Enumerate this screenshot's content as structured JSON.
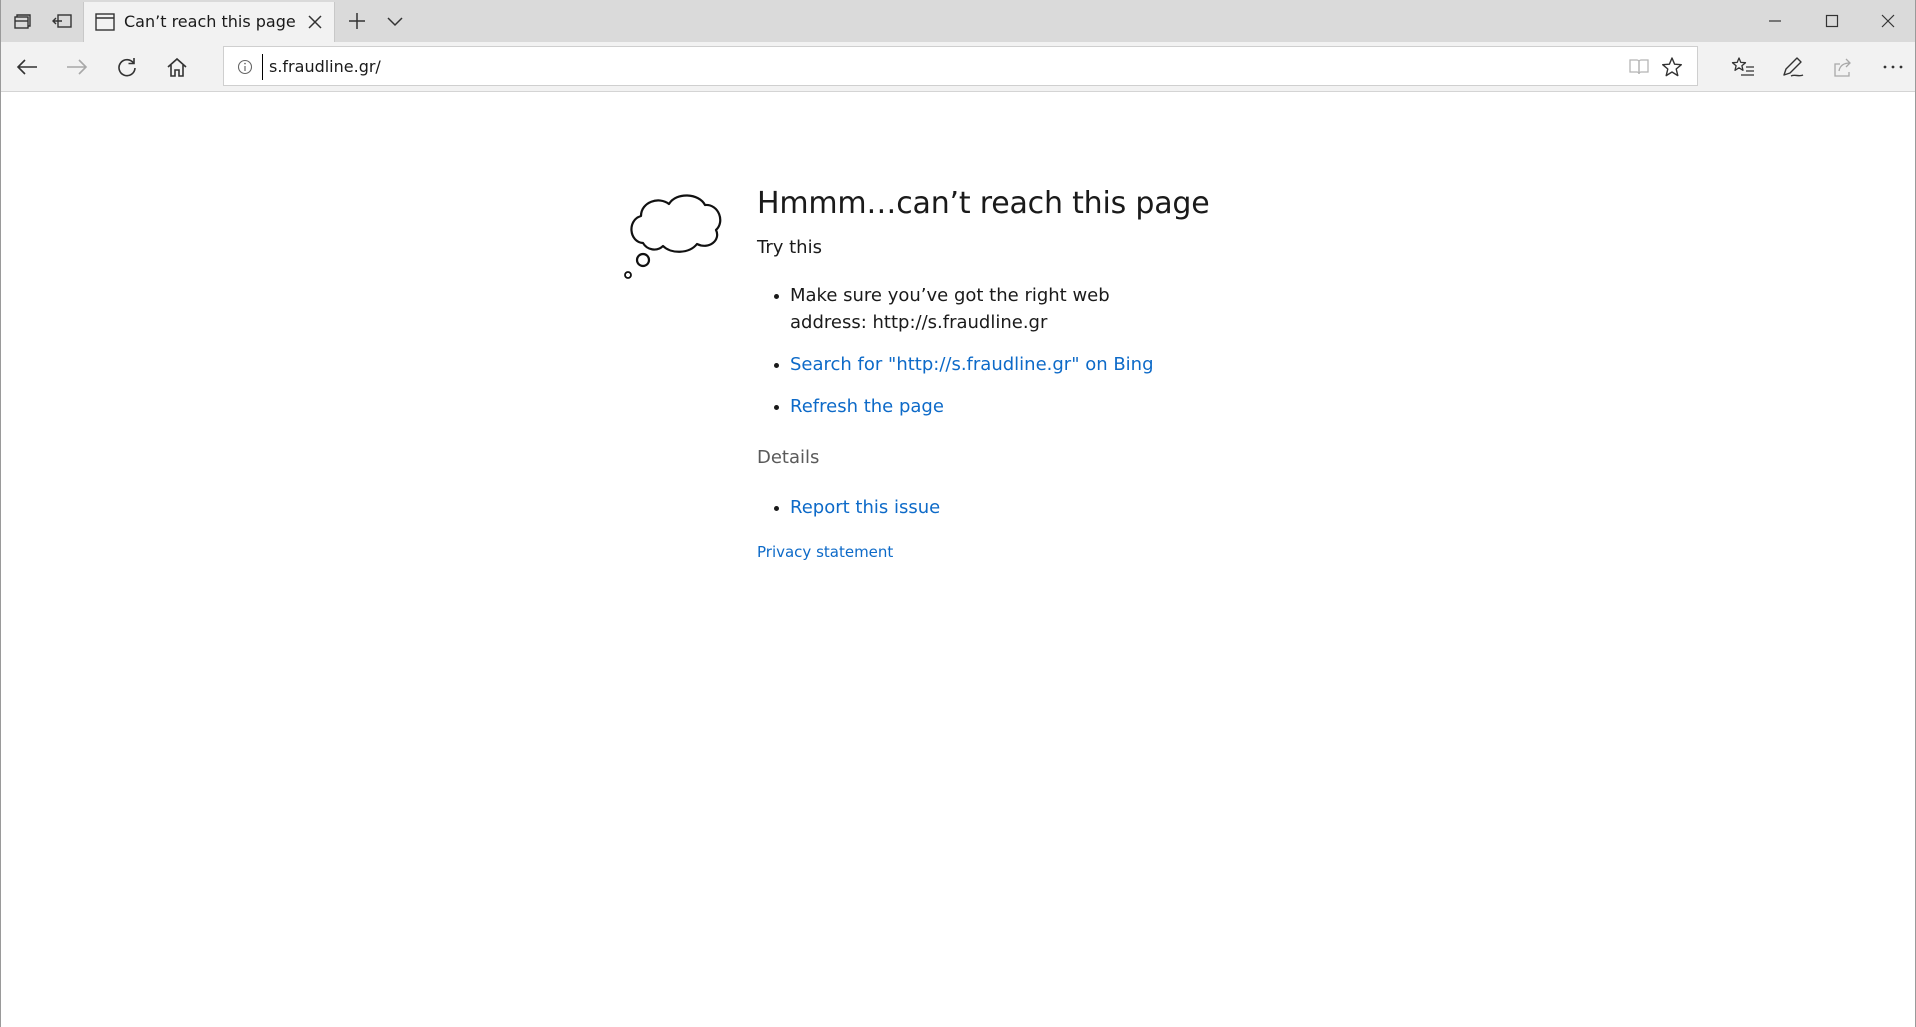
{
  "browser": {
    "tab": {
      "title": "Can’t reach this page"
    },
    "address_bar": {
      "url": "s.fraudline.gr/"
    },
    "icons": {
      "tab_actions": [
        "tabs-aside-icon",
        "restore-tabs-icon"
      ],
      "new_tab": "plus-icon",
      "tab_list": "chevron-down-icon",
      "nav": [
        "back-arrow-icon",
        "forward-arrow-icon",
        "refresh-icon",
        "home-icon"
      ],
      "toolbar": [
        "favorites-list-icon",
        "pen-icon",
        "share-icon",
        "more-icon"
      ],
      "window": [
        "minimize-icon",
        "maximize-icon",
        "close-icon"
      ]
    }
  },
  "error_page": {
    "title": "Hmmm…can’t reach this page",
    "try_this": "Try this",
    "suggestions": {
      "check_address": "Make sure you’ve got the right web address: http://s.fraudline.gr",
      "search_bing": "Search for \"http://s.fraudline.gr\" on Bing",
      "refresh": "Refresh the page"
    },
    "details_heading": "Details",
    "report_issue": "Report this issue",
    "privacy_statement": "Privacy statement"
  },
  "colors": {
    "link": "#0d6ac8",
    "titlebar": "#dadada",
    "toolbar": "#f2f2f2"
  }
}
